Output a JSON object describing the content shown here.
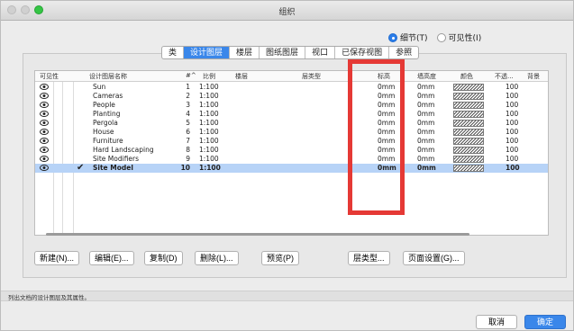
{
  "window": {
    "title": "组织"
  },
  "view_mode": {
    "options": [
      "细节(T)",
      "可见性(I)"
    ],
    "selected": "细节(T)"
  },
  "tabs": [
    "类",
    "设计图层",
    "楼层",
    "图纸图层",
    "视口",
    "已保存视图",
    "参照"
  ],
  "active_tab": "设计图层",
  "table": {
    "headers": [
      "可见性",
      "设计图层名称",
      "#^",
      "比例",
      "楼层",
      "层类型",
      "标高",
      "墙高度",
      "颜色",
      "不透...",
      "背景"
    ],
    "rows": [
      {
        "name": "Sun",
        "num": "1",
        "scale": "1:100",
        "elevation": "0mm",
        "wall_height": "0mm",
        "opacity": "100",
        "active": false
      },
      {
        "name": "Cameras",
        "num": "2",
        "scale": "1:100",
        "elevation": "0mm",
        "wall_height": "0mm",
        "opacity": "100",
        "active": false
      },
      {
        "name": "People",
        "num": "3",
        "scale": "1:100",
        "elevation": "0mm",
        "wall_height": "0mm",
        "opacity": "100",
        "active": false
      },
      {
        "name": "Planting",
        "num": "4",
        "scale": "1:100",
        "elevation": "0mm",
        "wall_height": "0mm",
        "opacity": "100",
        "active": false
      },
      {
        "name": "Pergola",
        "num": "5",
        "scale": "1:100",
        "elevation": "0mm",
        "wall_height": "0mm",
        "opacity": "100",
        "active": false
      },
      {
        "name": "House",
        "num": "6",
        "scale": "1:100",
        "elevation": "0mm",
        "wall_height": "0mm",
        "opacity": "100",
        "active": false
      },
      {
        "name": "Furniture",
        "num": "7",
        "scale": "1:100",
        "elevation": "0mm",
        "wall_height": "0mm",
        "opacity": "100",
        "active": false
      },
      {
        "name": "Hard Landscaping",
        "num": "8",
        "scale": "1:100",
        "elevation": "0mm",
        "wall_height": "0mm",
        "opacity": "100",
        "active": false
      },
      {
        "name": "Site Modifiers",
        "num": "9",
        "scale": "1:100",
        "elevation": "0mm",
        "wall_height": "0mm",
        "opacity": "100",
        "active": false
      },
      {
        "name": "Site Model",
        "num": "10",
        "scale": "1:100",
        "elevation": "0mm",
        "wall_height": "0mm",
        "opacity": "100",
        "active": true
      }
    ]
  },
  "buttons": {
    "new": "新建(N)...",
    "edit": "编辑(E)...",
    "duplicate": "复制(D)",
    "delete": "删除(L)...",
    "preview": "预览(P)",
    "layer_type": "层类型...",
    "page_setup": "页面设置(G)..."
  },
  "status": "列出文档的设计图层及其属性。",
  "footer": {
    "cancel": "取消",
    "ok": "确定"
  },
  "colors": {
    "accent": "#3a87ea",
    "selected_row": "#b7d3f7",
    "annotation": "#e53935"
  },
  "icons": {
    "visibility": "eye-icon",
    "active_layer": "checkmark-icon"
  }
}
